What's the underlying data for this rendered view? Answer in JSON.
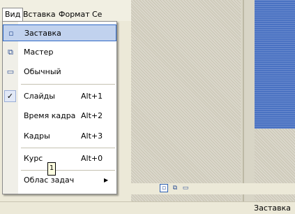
{
  "menubar": {
    "items": [
      {
        "label": "Вид"
      },
      {
        "label": "Вставка"
      },
      {
        "label": "Формат"
      },
      {
        "label": "Се"
      }
    ]
  },
  "view_menu": {
    "items": [
      {
        "label": "Заставка",
        "icon": "slide-view-icon",
        "icon_glyph": "▫",
        "shortcut": ""
      },
      {
        "label": "Мастер",
        "icon": "master-view-icon",
        "icon_glyph": "⧉",
        "shortcut": ""
      },
      {
        "label": "Обычный",
        "icon": "normal-view-icon",
        "icon_glyph": "▭",
        "shortcut": ""
      },
      {
        "label": "Слайды",
        "icon": "check-icon",
        "icon_glyph": "✓",
        "shortcut": "Alt+1"
      },
      {
        "label": "Время кадра",
        "shortcut": "Alt+2"
      },
      {
        "label": "Кадры",
        "shortcut": "Alt+3"
      },
      {
        "label": "Курс",
        "shortcut": "Alt+0"
      },
      {
        "label": "Облас задач",
        "arrow": "▶"
      }
    ],
    "checked_item": "Слайды"
  },
  "tooltip": {
    "text": "1"
  },
  "view_bar": {
    "icons": [
      "slide-view-icon",
      "master-view-icon",
      "normal-view-icon"
    ]
  },
  "statusbar": {
    "text": "Заставка"
  },
  "colors": {
    "highlight": "#c1d2ee",
    "highlight_border": "#316ac5",
    "slide_blue": "#4a72c2"
  }
}
